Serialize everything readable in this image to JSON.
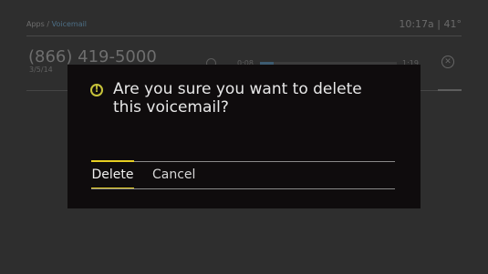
{
  "background": {
    "breadcrumb": {
      "root": "Apps",
      "separator": "/",
      "current": "Voicemail"
    },
    "status": {
      "time": "10:17a",
      "separator": "|",
      "temperature": "41°"
    },
    "voicemail": {
      "phone": "(866) 419-5000",
      "date": "3/5/14",
      "elapsed": "0:08",
      "duration": "1:19",
      "progress": 0.1,
      "close_glyph": "✕"
    }
  },
  "dialog": {
    "icon": "warning-icon",
    "icon_glyph": "!",
    "message": "Are you sure you want to delete this voicemail?",
    "buttons": {
      "delete_label": "Delete",
      "cancel_label": "Cancel"
    }
  },
  "colors": {
    "accent": "#e7cf22",
    "warning": "#c8c43a",
    "dialog_bg": "#0f0c0d"
  }
}
